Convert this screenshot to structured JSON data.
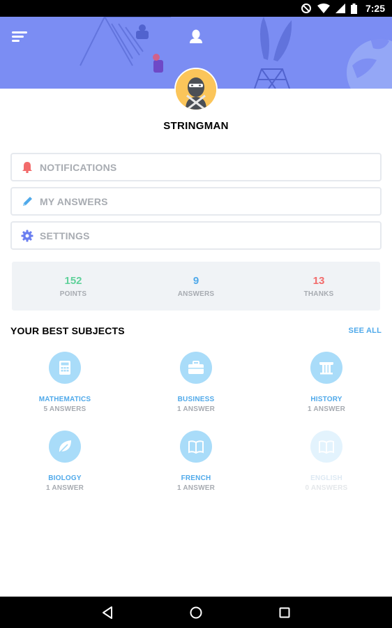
{
  "status_bar": {
    "time": "7:25",
    "icons": [
      "do-not-disturb-icon",
      "wifi-icon",
      "signal-icon",
      "battery-icon"
    ]
  },
  "header": {
    "background_color": "#7b8df3",
    "menu_icon": "hamburger-menu-icon",
    "profile_icon": "user-icon"
  },
  "profile": {
    "username": "STRINGMAN",
    "avatar": "ninja-avatar",
    "avatar_bg": "#fbc55a"
  },
  "menu": [
    {
      "label": "NOTIFICATIONS",
      "icon": "bell-icon",
      "icon_color": "#f26b6b"
    },
    {
      "label": "MY ANSWERS",
      "icon": "pencil-icon",
      "icon_color": "#4fa9ea"
    },
    {
      "label": "SETTINGS",
      "icon": "gear-icon",
      "icon_color": "#6a7ef0"
    }
  ],
  "stats": [
    {
      "value": "152",
      "label": "POINTS",
      "color": "#5fd19a"
    },
    {
      "value": "9",
      "label": "ANSWERS",
      "color": "#4fa9ea"
    },
    {
      "value": "13",
      "label": "THANKS",
      "color": "#f26b6b"
    }
  ],
  "subjects_section": {
    "title": "YOUR BEST SUBJECTS",
    "see_all": "SEE ALL"
  },
  "subjects": [
    {
      "name": "MATHEMATICS",
      "count": "5 ANSWERS",
      "icon": "calculator-icon",
      "enabled": true
    },
    {
      "name": "BUSINESS",
      "count": "1 ANSWER",
      "icon": "briefcase-icon",
      "enabled": true
    },
    {
      "name": "HISTORY",
      "count": "1 ANSWER",
      "icon": "column-icon",
      "enabled": true
    },
    {
      "name": "BIOLOGY",
      "count": "1 ANSWER",
      "icon": "leaf-icon",
      "enabled": true
    },
    {
      "name": "FRENCH",
      "count": "1 ANSWER",
      "icon": "book-icon",
      "enabled": true
    },
    {
      "name": "ENGLISH",
      "count": "0 ANSWERS",
      "icon": "book-icon",
      "enabled": false
    }
  ],
  "nav_bar": {
    "buttons": [
      "back-icon",
      "home-icon",
      "recents-icon"
    ]
  }
}
